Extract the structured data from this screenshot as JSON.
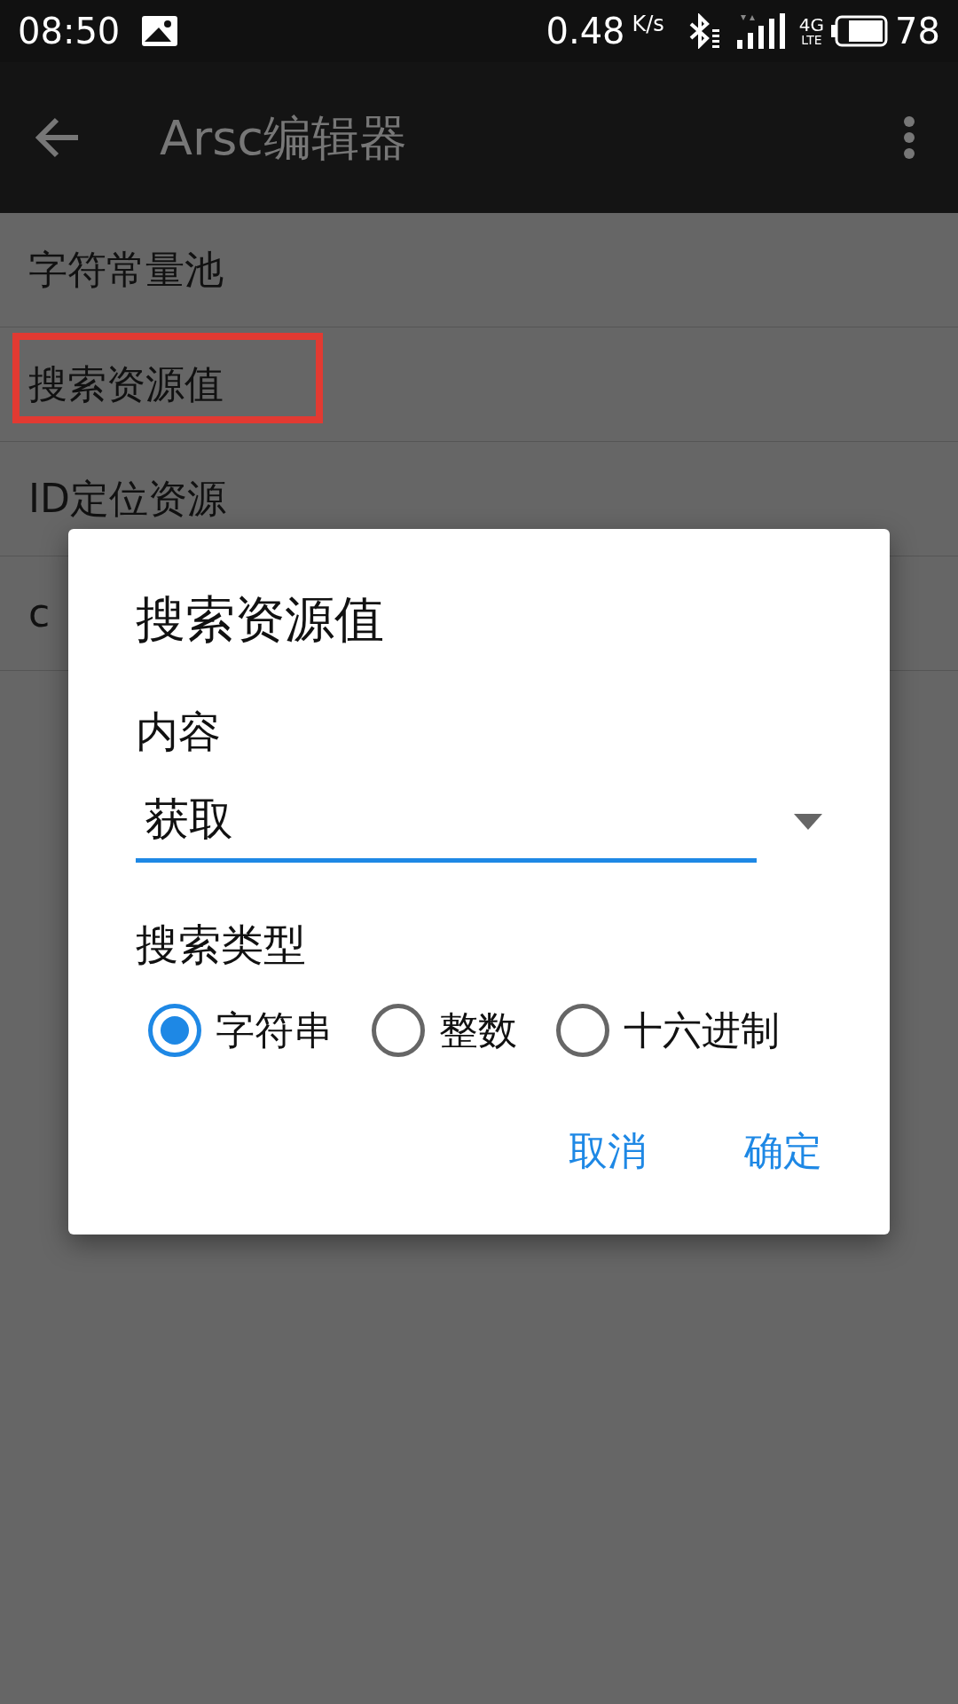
{
  "status_bar": {
    "time": "08:50",
    "speed": "0.48",
    "speed_unit": "K/s",
    "network": "4G",
    "network_sub": "LTE",
    "battery": "78"
  },
  "app_bar": {
    "title": "Arsc编辑器"
  },
  "list": [
    {
      "label": "字符常量池",
      "highlighted": false
    },
    {
      "label": "搜索资源值",
      "highlighted": true
    },
    {
      "label": "ID定位资源",
      "highlighted": false
    },
    {
      "label": "c",
      "highlighted": false
    }
  ],
  "dialog": {
    "title": "搜索资源值",
    "content_label": "内容",
    "content_value": "获取",
    "type_label": "搜索类型",
    "options": [
      {
        "label": "字符串",
        "selected": true
      },
      {
        "label": "整数",
        "selected": false
      },
      {
        "label": "十六进制",
        "selected": false
      }
    ],
    "buttons": [
      "取消",
      "确定"
    ]
  }
}
